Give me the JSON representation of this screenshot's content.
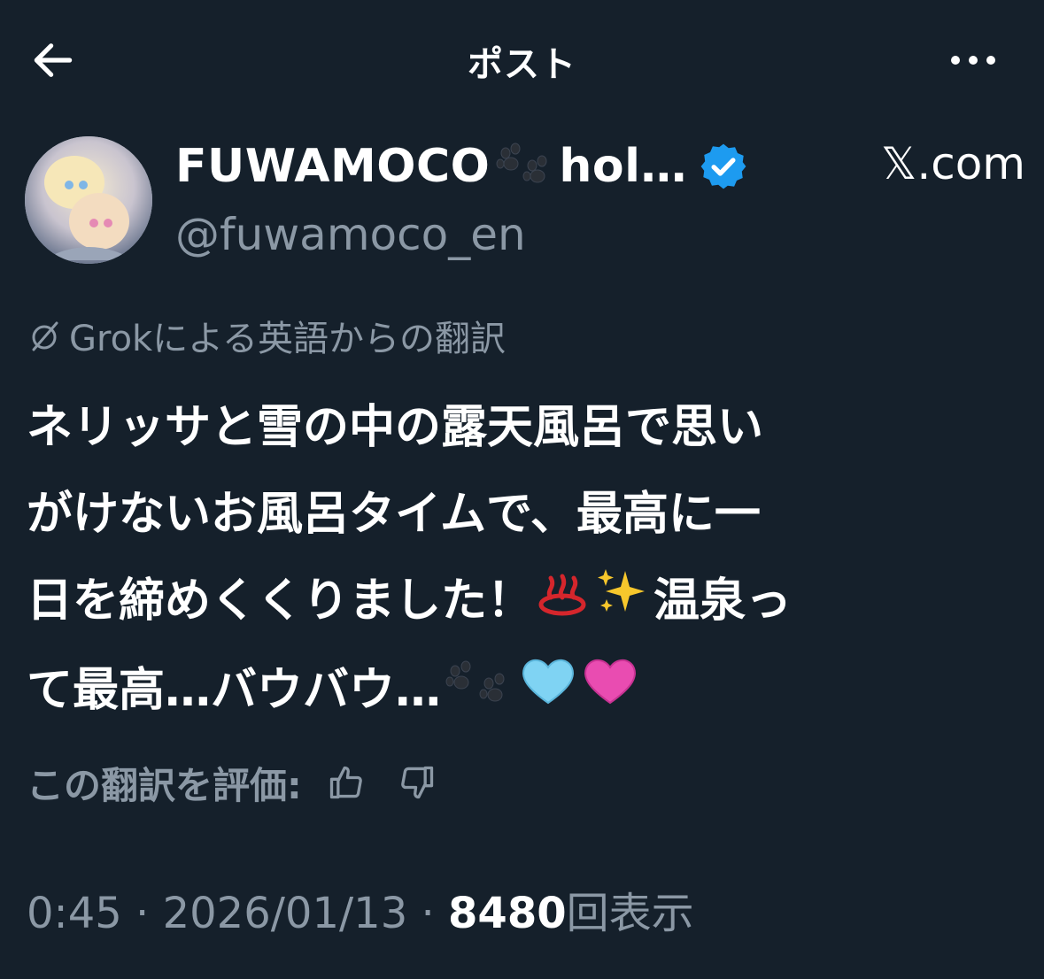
{
  "header": {
    "title": "ポスト",
    "back_icon": "arrow-left-icon",
    "more_icon": "more-horizontal-icon"
  },
  "author": {
    "display_name_a": "FUWAMOCO",
    "display_name_b": "hol…",
    "handle": "@fuwamoco_en",
    "source": "𝕏.com",
    "verified": true
  },
  "translation": {
    "label": "Grokによる英語からの翻訳"
  },
  "tweet": {
    "line1": "ネリッサと雪の中の露天風呂で思い",
    "line2": "がけないお風呂タイムで、最高に一",
    "line3a": "日を締めくくりました！",
    "line3b": "温泉っ",
    "line4a": "て最高…バウバウ…"
  },
  "rating": {
    "label": "この翻訳を評価:"
  },
  "meta": {
    "time": "0:45",
    "separator": " · ",
    "date": "2026/01/13",
    "views_count": "8480",
    "views_label": "回表示"
  },
  "colors": {
    "background": "#15202b",
    "text": "#ffffff",
    "muted": "#8b98a5",
    "verified": "#1d9bf0"
  }
}
